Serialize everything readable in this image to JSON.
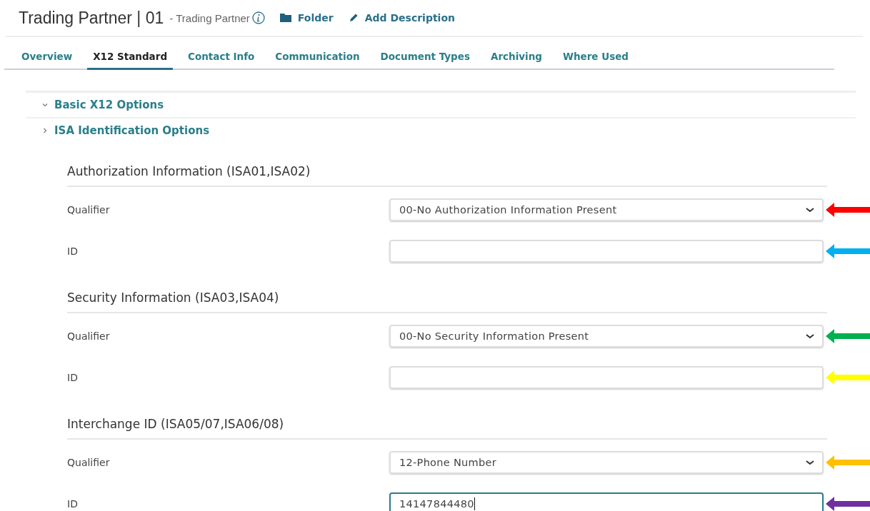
{
  "header": {
    "title": "Trading Partner | 01",
    "subtitle": "- Trading Partner",
    "actions": [
      {
        "kind": "folder",
        "label": "Folder"
      },
      {
        "kind": "edit",
        "label": "Add Description"
      }
    ]
  },
  "tabs": [
    {
      "label": "Overview",
      "selected": false
    },
    {
      "label": "X12 Standard",
      "selected": true
    },
    {
      "label": "Contact Info",
      "selected": false
    },
    {
      "label": "Communication",
      "selected": false
    },
    {
      "label": "Document Types",
      "selected": false
    },
    {
      "label": "Archiving",
      "selected": false
    },
    {
      "label": "Where Used",
      "selected": false
    }
  ],
  "accordions": [
    {
      "label": "Basic X12 Options",
      "expanded": true
    },
    {
      "label": "ISA Identification Options",
      "expanded": false
    }
  ],
  "sections": [
    {
      "title": "Authorization Information (ISA01,ISA02)",
      "fields": [
        {
          "kind": "select",
          "label": "Qualifier",
          "value": "00-No Authorization Information Present",
          "focused": false,
          "color": "#ff0000"
        },
        {
          "kind": "input",
          "label": "ID",
          "focused": false,
          "color": "#00b0f0"
        }
      ]
    },
    {
      "title": "Security Information (ISA03,ISA04)",
      "fields": [
        {
          "kind": "select",
          "label": "Qualifier",
          "value": "00-No Security Information Present",
          "focused": false,
          "color": "#00b050"
        },
        {
          "kind": "input",
          "label": "ID",
          "focused": false,
          "color": "#ffff00"
        }
      ]
    },
    {
      "title": "Interchange ID (ISA05/07,ISA06/08)",
      "fields": [
        {
          "kind": "select",
          "label": "Qualifier",
          "value": "12-Phone Number",
          "focused": false,
          "color": "#ffc000"
        },
        {
          "kind": "input",
          "label": "ID",
          "value": "14147844480",
          "focused": true,
          "color": "#7030a0"
        }
      ]
    }
  ]
}
